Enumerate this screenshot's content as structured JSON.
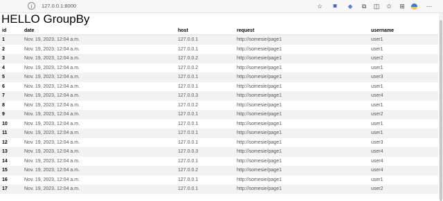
{
  "browser": {
    "url": "127.0.0.1:8000",
    "info_icon": "info-icon",
    "toolbar_icons": [
      "read-aloud-icon",
      "favorite-star-icon",
      "extension-icon",
      "extension-icon",
      "extensions-icon",
      "split-screen-icon",
      "favorites-icon",
      "collections-icon",
      "profile-icon",
      "more-icon"
    ]
  },
  "page": {
    "title": "HELLO GroupBy"
  },
  "table": {
    "headers": [
      "id",
      "date",
      "host",
      "request",
      "username"
    ],
    "rows": [
      [
        "1",
        "Nov. 19, 2023, 12:04 a.m.",
        "127.0.0.1",
        "http://somesie/page1",
        "user1"
      ],
      [
        "2",
        "Nov. 19, 2023, 12:04 a.m.",
        "127.0.0.1",
        "http://somesie/page1",
        "user1"
      ],
      [
        "3",
        "Nov. 19, 2023, 12:04 a.m.",
        "127.0.0.2",
        "http://somesie/page1",
        "user2"
      ],
      [
        "4",
        "Nov. 19, 2023, 12:04 a.m.",
        "127.0.0.2",
        "http://somesie/page1",
        "user1"
      ],
      [
        "5",
        "Nov. 19, 2023, 12:04 a.m.",
        "127.0.0.1",
        "http://somesie/page1",
        "user3"
      ],
      [
        "6",
        "Nov. 19, 2023, 12:04 a.m.",
        "127.0.0.1",
        "http://somesie/page1",
        "user1"
      ],
      [
        "7",
        "Nov. 19, 2023, 12:04 a.m.",
        "127.0.0.3",
        "http://somesie/page1",
        "user4"
      ],
      [
        "8",
        "Nov. 19, 2023, 12:04 a.m.",
        "127.0.0.2",
        "http://somesie/page1",
        "user1"
      ],
      [
        "9",
        "Nov. 19, 2023, 12:04 a.m.",
        "127.0.0.1",
        "http://somesie/page1",
        "user2"
      ],
      [
        "10",
        "Nov. 19, 2023, 12:04 a.m.",
        "127.0.0.1",
        "http://somesie/page1",
        "user1"
      ],
      [
        "11",
        "Nov. 19, 2023, 12:04 a.m.",
        "127.0.0.1",
        "http://somesie/page1",
        "user1"
      ],
      [
        "12",
        "Nov. 19, 2023, 12:04 a.m.",
        "127.0.0.1",
        "http://somesie/page1",
        "user3"
      ],
      [
        "13",
        "Nov. 19, 2023, 12:04 a.m.",
        "127.0.0.3",
        "http://somesie/page1",
        "user4"
      ],
      [
        "14",
        "Nov. 19, 2023, 12:04 a.m.",
        "127.0.0.1",
        "http://somesie/page1",
        "user4"
      ],
      [
        "15",
        "Nov. 19, 2023, 12:04 a.m.",
        "127.0.0.2",
        "http://somesie/page1",
        "user4"
      ],
      [
        "16",
        "Nov. 19, 2023, 12:04 a.m.",
        "127.0.0.1",
        "http://somesie/page1",
        "user1"
      ],
      [
        "17",
        "Nov. 19, 2023, 12:04 a.m.",
        "127.0.0.1",
        "http://somesie/page1",
        "user2"
      ]
    ]
  }
}
